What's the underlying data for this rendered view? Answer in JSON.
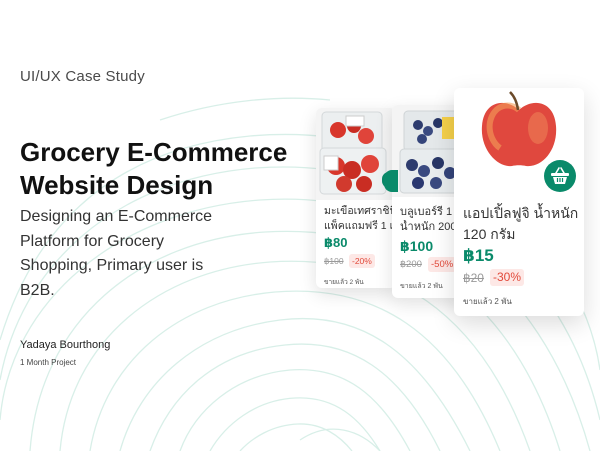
{
  "colors": {
    "brand_green": "#0a8a6a",
    "price_green": "#0a8a6a",
    "discount_red": "#e24a3b",
    "discount_bg": "#fde8e6",
    "line_color": "#d8efe8"
  },
  "hero": {
    "eyebrow": "UI/UX Case Study",
    "title": "Grocery E-Commerce Website Design",
    "subtitle": "Designing an E-Commerce Platform for Grocery Shopping, Primary user is B2B.",
    "author": "Yadaya Bourthong",
    "duration": "1 Month Project"
  },
  "cards": [
    {
      "name_line1": "มะเขือเทศราชินี ซื้",
      "name_line2": "แพ็คแถมฟรี 1 แพ็",
      "price": "฿80",
      "old_price": "฿100",
      "discount": "-20%",
      "sold": "ขายแล้ว 2 พัน"
    },
    {
      "name_line1": "บลูเบอร์รี่ 1 แ",
      "name_line2": "น้ำหนัก 200",
      "price": "฿100",
      "old_price": "฿200",
      "discount": "-50%",
      "sold": "ขายแล้ว 2 พัน"
    },
    {
      "name_line1": "แอปเปิ้ลฟูจิ น้ำหนัก",
      "name_line2": "120 กรัม",
      "price": "฿15",
      "old_price": "฿20",
      "discount": "-30%",
      "sold": "ขายแล้ว 2 พัน",
      "cart_icon": "basket-icon"
    }
  ]
}
